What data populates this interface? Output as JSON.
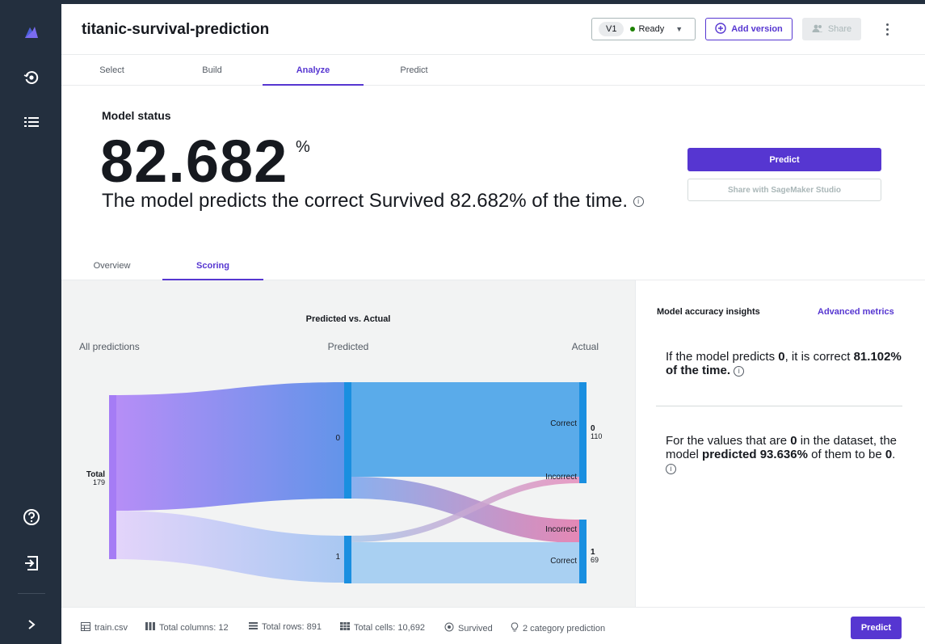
{
  "header": {
    "title": "titanic-survival-prediction",
    "version": "V1",
    "status": "Ready",
    "add_version": "Add version",
    "share": "Share"
  },
  "tabs": [
    "Select",
    "Build",
    "Analyze",
    "Predict"
  ],
  "model_status": {
    "heading": "Model status",
    "accuracy": "82.682",
    "percent_sign": "%",
    "description": "The model predicts the correct Survived 82.682% of the time.",
    "predict_button": "Predict",
    "share_button": "Share with SageMaker Studio"
  },
  "subtabs": [
    "Overview",
    "Scoring"
  ],
  "sankey": {
    "title": "Predicted vs. Actual",
    "col_all": "All predictions",
    "col_predicted": "Predicted",
    "col_actual": "Actual",
    "total_label": "Total",
    "total_value": "179",
    "pred_0": "0",
    "pred_1": "1",
    "correct": "Correct",
    "incorrect": "Incorrect",
    "actual_0": "0",
    "actual_0_count": "110",
    "actual_1": "1",
    "actual_1_count": "69"
  },
  "insights": {
    "title": "Model accuracy insights",
    "advanced": "Advanced metrics",
    "i1_a": "If the model predicts ",
    "i1_b": "0",
    "i1_c": ", it is correct ",
    "i1_d": "81.102% of the time.",
    "i2_a": "For the values that are ",
    "i2_b": "0",
    "i2_c": " in the dataset, the model ",
    "i2_d": "predicted 93.636%",
    "i2_e": " of them to be ",
    "i2_f": "0",
    "i2_g": "."
  },
  "footer": {
    "file": "train.csv",
    "columns": "Total columns: 12",
    "rows": "Total rows: 891",
    "cells": "Total cells: 10,692",
    "target": "Survived",
    "prediction_type": "2 category prediction",
    "predict": "Predict"
  },
  "colors": {
    "accent": "#5636d1",
    "node_blue": "#1a8fe0",
    "node_purple": "#a57cf5",
    "incorrect_pink": "#e37cae"
  },
  "icons": [
    "canvas-logo-icon",
    "models-icon",
    "list-icon",
    "help-icon",
    "sign-out-icon",
    "expand-icon",
    "add-circle-icon",
    "share-users-icon",
    "more-vert-icon",
    "info-icon",
    "table-icon",
    "columns-icon",
    "rows-icon",
    "cells-icon",
    "target-icon",
    "lightbulb-icon"
  ]
}
